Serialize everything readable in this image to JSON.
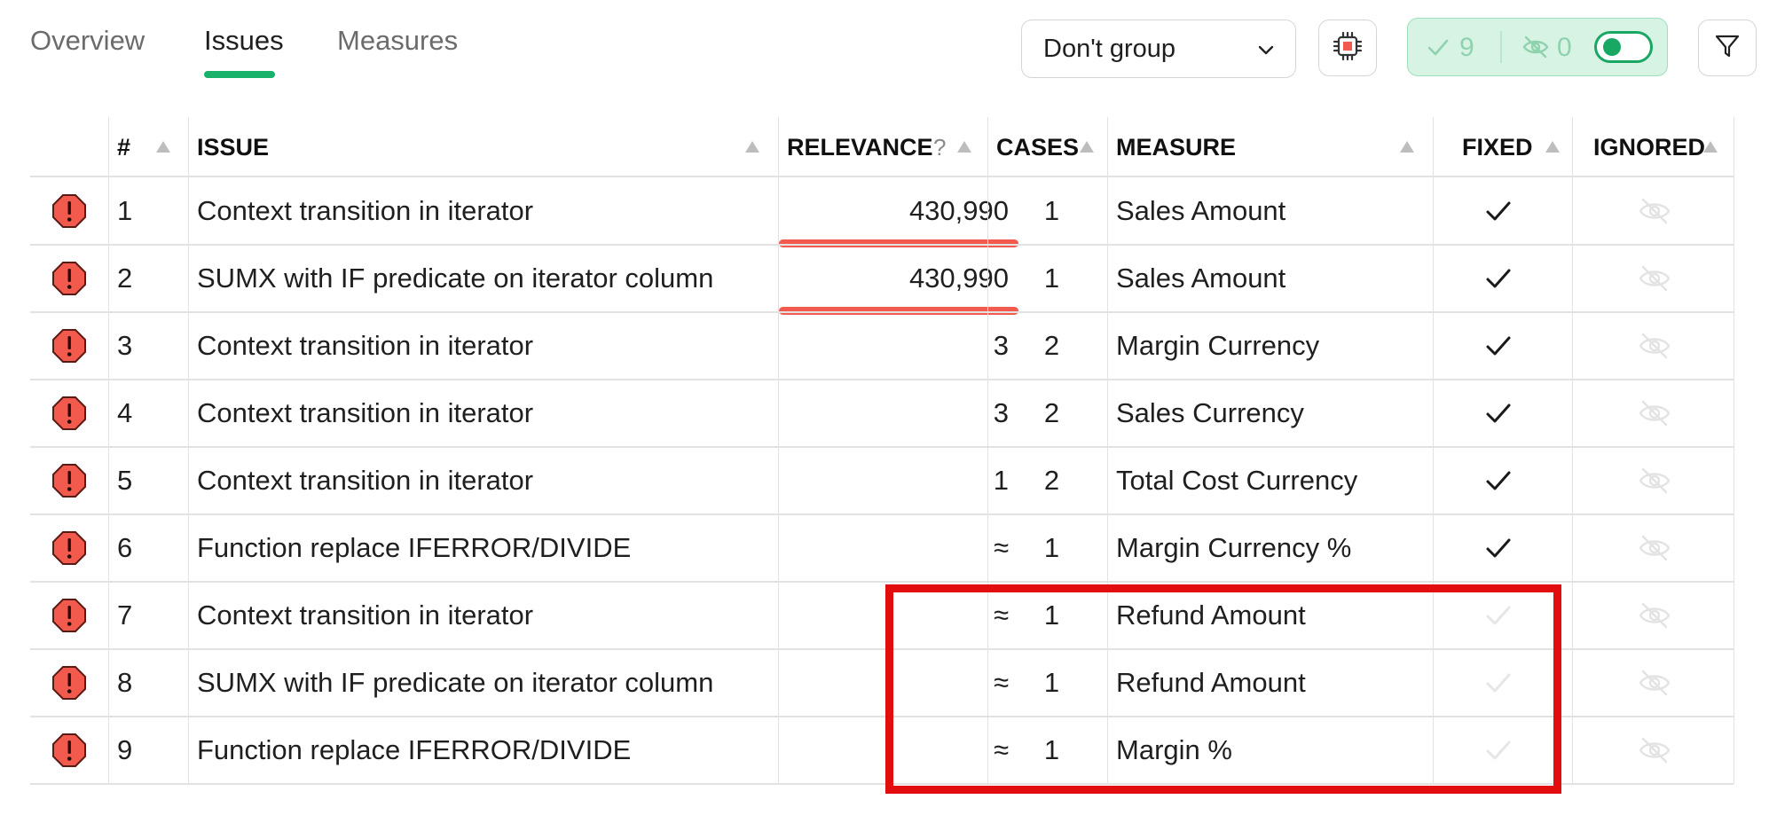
{
  "tabs": [
    {
      "label": "Overview",
      "active": false
    },
    {
      "label": "Issues",
      "active": true
    },
    {
      "label": "Measures",
      "active": false
    }
  ],
  "toolbar": {
    "group_by_value": "Don't group",
    "fixed_count": "9",
    "ignored_count": "0"
  },
  "table": {
    "columns": {
      "number": "#",
      "issue": "ISSUE",
      "relevance": "RELEVANCE",
      "relevance_help": "?",
      "cases": "CASES",
      "measure": "MEASURE",
      "fixed": "FIXED",
      "ignored": "IGNORED"
    },
    "rows": [
      {
        "num": "1",
        "issue": "Context transition in iterator",
        "relevance": "430,990",
        "cases": "1",
        "measure": "Sales Amount",
        "fixed": true,
        "ignored": false,
        "relevance_bar": true
      },
      {
        "num": "2",
        "issue": "SUMX with IF predicate on iterator column",
        "relevance": "430,990",
        "cases": "1",
        "measure": "Sales Amount",
        "fixed": true,
        "ignored": false,
        "relevance_bar": true
      },
      {
        "num": "3",
        "issue": "Context transition in iterator",
        "relevance": "3",
        "cases": "2",
        "measure": "Margin Currency",
        "fixed": true,
        "ignored": false,
        "relevance_bar": false
      },
      {
        "num": "4",
        "issue": "Context transition in iterator",
        "relevance": "3",
        "cases": "2",
        "measure": "Sales Currency",
        "fixed": true,
        "ignored": false,
        "relevance_bar": false
      },
      {
        "num": "5",
        "issue": "Context transition in iterator",
        "relevance": "1",
        "cases": "2",
        "measure": "Total Cost Currency",
        "fixed": true,
        "ignored": false,
        "relevance_bar": false
      },
      {
        "num": "6",
        "issue": "Function replace IFERROR/DIVIDE",
        "relevance": "≈",
        "cases": "1",
        "measure": "Margin Currency %",
        "fixed": true,
        "ignored": false,
        "relevance_bar": false
      },
      {
        "num": "7",
        "issue": "Context transition in iterator",
        "relevance": "≈",
        "cases": "1",
        "measure": "Refund Amount",
        "fixed": false,
        "ignored": false,
        "relevance_bar": false
      },
      {
        "num": "8",
        "issue": "SUMX with IF predicate on iterator column",
        "relevance": "≈",
        "cases": "1",
        "measure": "Refund Amount",
        "fixed": false,
        "ignored": false,
        "relevance_bar": false
      },
      {
        "num": "9",
        "issue": "Function replace IFERROR/DIVIDE",
        "relevance": "≈",
        "cases": "1",
        "measure": "Margin %",
        "fixed": false,
        "ignored": false,
        "relevance_bar": false
      }
    ]
  },
  "colors": {
    "accent": "#18b26b",
    "severity_fill": "#f25a4d",
    "relevance_bar": "#f25a4d",
    "highlight_border": "#e20d0d",
    "status_pill_bg": "#d7f3e4"
  },
  "icons": {
    "severity": "error-octagon-icon",
    "fixed": "check-icon",
    "ignored": "eye-off-icon",
    "chip": "cpu-chip-icon",
    "filter": "filter-icon",
    "dropdown": "chevron-down-icon"
  }
}
